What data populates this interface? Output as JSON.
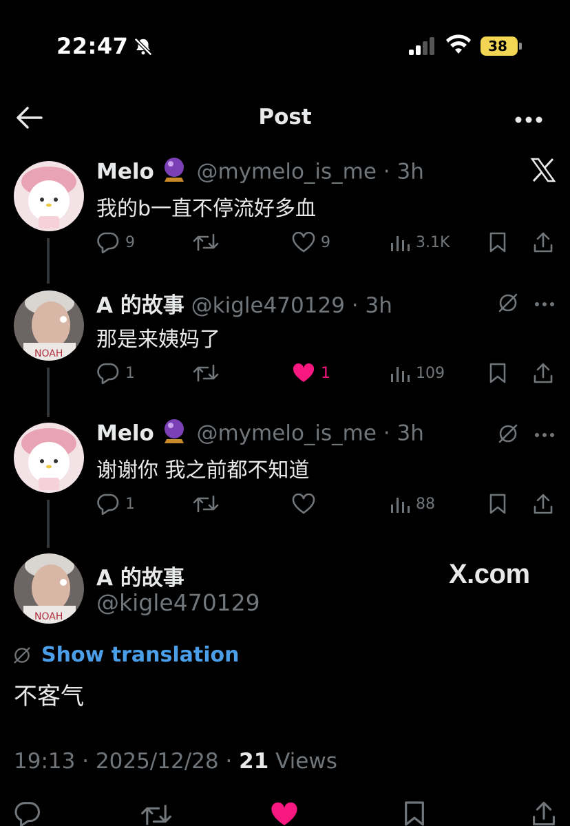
{
  "status": {
    "time": "22:47",
    "battery": "38"
  },
  "header": {
    "title": "Post"
  },
  "thread": [
    {
      "name": "Melo",
      "handle": "@mymelo_is_me",
      "age": "3h",
      "text": "我的b一直不停流好多血",
      "replies": "9",
      "retweets": "",
      "likes": "9",
      "views": "3.1K",
      "liked": false
    },
    {
      "name": "A 的故事",
      "handle": "@kigle470129",
      "age": "3h",
      "text": "那是来姨妈了",
      "replies": "1",
      "retweets": "",
      "likes": "1",
      "views": "109",
      "liked": true
    },
    {
      "name": "Melo",
      "handle": "@mymelo_is_me",
      "age": "3h",
      "text": "谢谢你 我之前都不知道",
      "replies": "1",
      "retweets": "",
      "likes": "",
      "views": "88",
      "liked": false
    }
  ],
  "main": {
    "name": "A 的故事",
    "handle": "@kigle470129",
    "show_translation": "Show translation",
    "text": "不客气",
    "time": "19:13",
    "date": "2025/12/28",
    "views_count": "21",
    "views_label": "Views"
  },
  "watermark": {
    "xcom": "X.com"
  },
  "colors": {
    "background": "#000000",
    "muted": "#71767b",
    "link": "#1d9bf0",
    "like": "#f91880",
    "battery": "#f2d552"
  }
}
